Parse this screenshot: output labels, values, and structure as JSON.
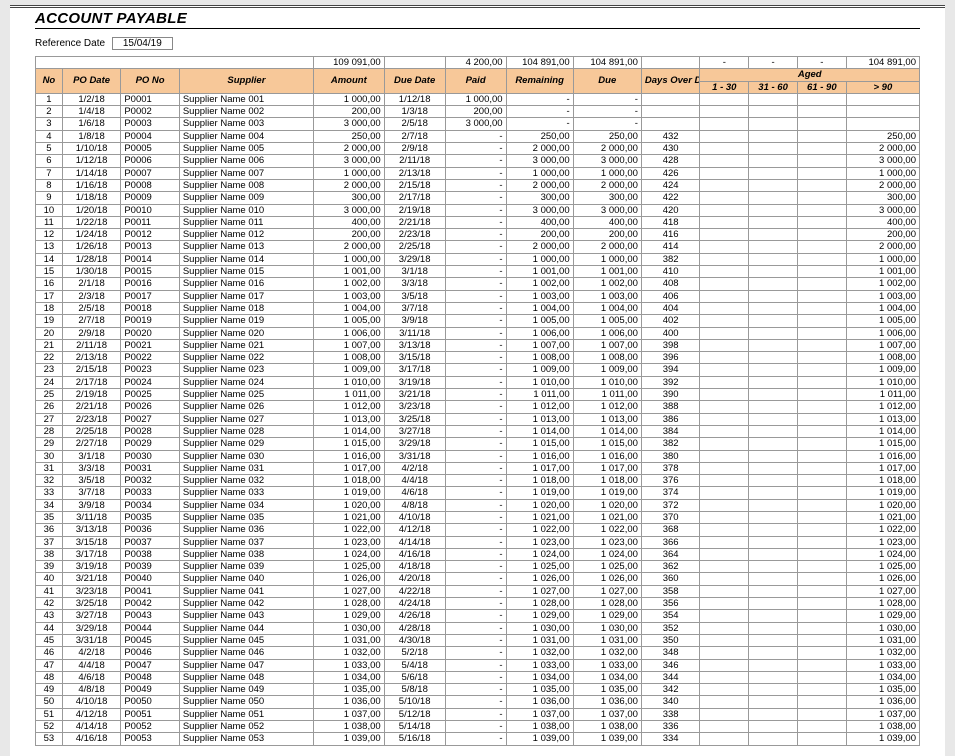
{
  "header": {
    "title": "ACCOUNT PAYABLE",
    "reference_label": "Reference Date",
    "reference_date": "15/04/19"
  },
  "totals": {
    "amount": "109  091,00",
    "paid": "4  200,00",
    "remaining": "104  891,00",
    "due": "104  891,00",
    "b1": "-",
    "b2": "-",
    "b3": "-",
    "b4": "104  891,00"
  },
  "columns": {
    "no": "No",
    "po_date": "PO Date",
    "po_no": "PO No",
    "supplier": "Supplier",
    "amount": "Amount",
    "due_date": "Due Date",
    "paid": "Paid",
    "remaining": "Remaining",
    "due": "Due",
    "days_over": "Days Over Due",
    "aged": "Aged",
    "b1": "1 - 30",
    "b2": "31 - 60",
    "b3": "61 - 90",
    "b4": "> 90"
  },
  "rows": [
    {
      "no": "1",
      "po_date": "1/2/18",
      "po_no": "P0001",
      "supplier": "Supplier Name 001",
      "amount": "1  000,00",
      "due_date": "1/12/18",
      "paid": "1  000,00",
      "remaining": "-",
      "due": "-",
      "days": "",
      "b4": ""
    },
    {
      "no": "2",
      "po_date": "1/4/18",
      "po_no": "P0002",
      "supplier": "Supplier Name 002",
      "amount": "200,00",
      "due_date": "1/3/18",
      "paid": "200,00",
      "remaining": "-",
      "due": "-",
      "days": "",
      "b4": ""
    },
    {
      "no": "3",
      "po_date": "1/6/18",
      "po_no": "P0003",
      "supplier": "Supplier Name 003",
      "amount": "3  000,00",
      "due_date": "2/5/18",
      "paid": "3  000,00",
      "remaining": "-",
      "due": "-",
      "days": "",
      "b4": ""
    },
    {
      "no": "4",
      "po_date": "1/8/18",
      "po_no": "P0004",
      "supplier": "Supplier Name 004",
      "amount": "250,00",
      "due_date": "2/7/18",
      "paid": "-",
      "remaining": "250,00",
      "due": "250,00",
      "days": "432",
      "b4": "250,00"
    },
    {
      "no": "5",
      "po_date": "1/10/18",
      "po_no": "P0005",
      "supplier": "Supplier Name 005",
      "amount": "2  000,00",
      "due_date": "2/9/18",
      "paid": "-",
      "remaining": "2  000,00",
      "due": "2  000,00",
      "days": "430",
      "b4": "2  000,00"
    },
    {
      "no": "6",
      "po_date": "1/12/18",
      "po_no": "P0006",
      "supplier": "Supplier Name 006",
      "amount": "3  000,00",
      "due_date": "2/11/18",
      "paid": "-",
      "remaining": "3  000,00",
      "due": "3  000,00",
      "days": "428",
      "b4": "3  000,00"
    },
    {
      "no": "7",
      "po_date": "1/14/18",
      "po_no": "P0007",
      "supplier": "Supplier Name 007",
      "amount": "1  000,00",
      "due_date": "2/13/18",
      "paid": "-",
      "remaining": "1  000,00",
      "due": "1  000,00",
      "days": "426",
      "b4": "1  000,00"
    },
    {
      "no": "8",
      "po_date": "1/16/18",
      "po_no": "P0008",
      "supplier": "Supplier Name 008",
      "amount": "2  000,00",
      "due_date": "2/15/18",
      "paid": "-",
      "remaining": "2  000,00",
      "due": "2  000,00",
      "days": "424",
      "b4": "2  000,00"
    },
    {
      "no": "9",
      "po_date": "1/18/18",
      "po_no": "P0009",
      "supplier": "Supplier Name 009",
      "amount": "300,00",
      "due_date": "2/17/18",
      "paid": "-",
      "remaining": "300,00",
      "due": "300,00",
      "days": "422",
      "b4": "300,00"
    },
    {
      "no": "10",
      "po_date": "1/20/18",
      "po_no": "P0010",
      "supplier": "Supplier Name 010",
      "amount": "3  000,00",
      "due_date": "2/19/18",
      "paid": "-",
      "remaining": "3  000,00",
      "due": "3  000,00",
      "days": "420",
      "b4": "3  000,00"
    },
    {
      "no": "11",
      "po_date": "1/22/18",
      "po_no": "P0011",
      "supplier": "Supplier Name 011",
      "amount": "400,00",
      "due_date": "2/21/18",
      "paid": "-",
      "remaining": "400,00",
      "due": "400,00",
      "days": "418",
      "b4": "400,00"
    },
    {
      "no": "12",
      "po_date": "1/24/18",
      "po_no": "P0012",
      "supplier": "Supplier Name 012",
      "amount": "200,00",
      "due_date": "2/23/18",
      "paid": "-",
      "remaining": "200,00",
      "due": "200,00",
      "days": "416",
      "b4": "200,00"
    },
    {
      "no": "13",
      "po_date": "1/26/18",
      "po_no": "P0013",
      "supplier": "Supplier Name 013",
      "amount": "2  000,00",
      "due_date": "2/25/18",
      "paid": "-",
      "remaining": "2  000,00",
      "due": "2  000,00",
      "days": "414",
      "b4": "2  000,00"
    },
    {
      "no": "14",
      "po_date": "1/28/18",
      "po_no": "P0014",
      "supplier": "Supplier Name 014",
      "amount": "1  000,00",
      "due_date": "3/29/18",
      "paid": "-",
      "remaining": "1  000,00",
      "due": "1  000,00",
      "days": "382",
      "b4": "1  000,00"
    },
    {
      "no": "15",
      "po_date": "1/30/18",
      "po_no": "P0015",
      "supplier": "Supplier Name 015",
      "amount": "1  001,00",
      "due_date": "3/1/18",
      "paid": "-",
      "remaining": "1  001,00",
      "due": "1  001,00",
      "days": "410",
      "b4": "1  001,00"
    },
    {
      "no": "16",
      "po_date": "2/1/18",
      "po_no": "P0016",
      "supplier": "Supplier Name 016",
      "amount": "1  002,00",
      "due_date": "3/3/18",
      "paid": "-",
      "remaining": "1  002,00",
      "due": "1  002,00",
      "days": "408",
      "b4": "1  002,00"
    },
    {
      "no": "17",
      "po_date": "2/3/18",
      "po_no": "P0017",
      "supplier": "Supplier Name 017",
      "amount": "1  003,00",
      "due_date": "3/5/18",
      "paid": "-",
      "remaining": "1  003,00",
      "due": "1  003,00",
      "days": "406",
      "b4": "1  003,00"
    },
    {
      "no": "18",
      "po_date": "2/5/18",
      "po_no": "P0018",
      "supplier": "Supplier Name 018",
      "amount": "1  004,00",
      "due_date": "3/7/18",
      "paid": "-",
      "remaining": "1  004,00",
      "due": "1  004,00",
      "days": "404",
      "b4": "1  004,00"
    },
    {
      "no": "19",
      "po_date": "2/7/18",
      "po_no": "P0019",
      "supplier": "Supplier Name 019",
      "amount": "1  005,00",
      "due_date": "3/9/18",
      "paid": "-",
      "remaining": "1  005,00",
      "due": "1  005,00",
      "days": "402",
      "b4": "1  005,00"
    },
    {
      "no": "20",
      "po_date": "2/9/18",
      "po_no": "P0020",
      "supplier": "Supplier Name 020",
      "amount": "1  006,00",
      "due_date": "3/11/18",
      "paid": "-",
      "remaining": "1  006,00",
      "due": "1  006,00",
      "days": "400",
      "b4": "1  006,00"
    },
    {
      "no": "21",
      "po_date": "2/11/18",
      "po_no": "P0021",
      "supplier": "Supplier Name 021",
      "amount": "1  007,00",
      "due_date": "3/13/18",
      "paid": "-",
      "remaining": "1  007,00",
      "due": "1  007,00",
      "days": "398",
      "b4": "1  007,00"
    },
    {
      "no": "22",
      "po_date": "2/13/18",
      "po_no": "P0022",
      "supplier": "Supplier Name 022",
      "amount": "1  008,00",
      "due_date": "3/15/18",
      "paid": "-",
      "remaining": "1  008,00",
      "due": "1  008,00",
      "days": "396",
      "b4": "1  008,00"
    },
    {
      "no": "23",
      "po_date": "2/15/18",
      "po_no": "P0023",
      "supplier": "Supplier Name 023",
      "amount": "1  009,00",
      "due_date": "3/17/18",
      "paid": "-",
      "remaining": "1  009,00",
      "due": "1  009,00",
      "days": "394",
      "b4": "1  009,00"
    },
    {
      "no": "24",
      "po_date": "2/17/18",
      "po_no": "P0024",
      "supplier": "Supplier Name 024",
      "amount": "1  010,00",
      "due_date": "3/19/18",
      "paid": "-",
      "remaining": "1  010,00",
      "due": "1  010,00",
      "days": "392",
      "b4": "1  010,00"
    },
    {
      "no": "25",
      "po_date": "2/19/18",
      "po_no": "P0025",
      "supplier": "Supplier Name 025",
      "amount": "1  011,00",
      "due_date": "3/21/18",
      "paid": "-",
      "remaining": "1  011,00",
      "due": "1  011,00",
      "days": "390",
      "b4": "1  011,00"
    },
    {
      "no": "26",
      "po_date": "2/21/18",
      "po_no": "P0026",
      "supplier": "Supplier Name 026",
      "amount": "1  012,00",
      "due_date": "3/23/18",
      "paid": "-",
      "remaining": "1  012,00",
      "due": "1  012,00",
      "days": "388",
      "b4": "1  012,00"
    },
    {
      "no": "27",
      "po_date": "2/23/18",
      "po_no": "P0027",
      "supplier": "Supplier Name 027",
      "amount": "1  013,00",
      "due_date": "3/25/18",
      "paid": "-",
      "remaining": "1  013,00",
      "due": "1  013,00",
      "days": "386",
      "b4": "1  013,00"
    },
    {
      "no": "28",
      "po_date": "2/25/18",
      "po_no": "P0028",
      "supplier": "Supplier Name 028",
      "amount": "1  014,00",
      "due_date": "3/27/18",
      "paid": "-",
      "remaining": "1  014,00",
      "due": "1  014,00",
      "days": "384",
      "b4": "1  014,00"
    },
    {
      "no": "29",
      "po_date": "2/27/18",
      "po_no": "P0029",
      "supplier": "Supplier Name 029",
      "amount": "1  015,00",
      "due_date": "3/29/18",
      "paid": "-",
      "remaining": "1  015,00",
      "due": "1  015,00",
      "days": "382",
      "b4": "1  015,00"
    },
    {
      "no": "30",
      "po_date": "3/1/18",
      "po_no": "P0030",
      "supplier": "Supplier Name 030",
      "amount": "1  016,00",
      "due_date": "3/31/18",
      "paid": "-",
      "remaining": "1  016,00",
      "due": "1  016,00",
      "days": "380",
      "b4": "1  016,00"
    },
    {
      "no": "31",
      "po_date": "3/3/18",
      "po_no": "P0031",
      "supplier": "Supplier Name 031",
      "amount": "1  017,00",
      "due_date": "4/2/18",
      "paid": "-",
      "remaining": "1  017,00",
      "due": "1  017,00",
      "days": "378",
      "b4": "1  017,00"
    },
    {
      "no": "32",
      "po_date": "3/5/18",
      "po_no": "P0032",
      "supplier": "Supplier Name 032",
      "amount": "1  018,00",
      "due_date": "4/4/18",
      "paid": "-",
      "remaining": "1  018,00",
      "due": "1  018,00",
      "days": "376",
      "b4": "1  018,00"
    },
    {
      "no": "33",
      "po_date": "3/7/18",
      "po_no": "P0033",
      "supplier": "Supplier Name 033",
      "amount": "1  019,00",
      "due_date": "4/6/18",
      "paid": "-",
      "remaining": "1  019,00",
      "due": "1  019,00",
      "days": "374",
      "b4": "1  019,00"
    },
    {
      "no": "34",
      "po_date": "3/9/18",
      "po_no": "P0034",
      "supplier": "Supplier Name 034",
      "amount": "1  020,00",
      "due_date": "4/8/18",
      "paid": "-",
      "remaining": "1  020,00",
      "due": "1  020,00",
      "days": "372",
      "b4": "1  020,00"
    },
    {
      "no": "35",
      "po_date": "3/11/18",
      "po_no": "P0035",
      "supplier": "Supplier Name 035",
      "amount": "1  021,00",
      "due_date": "4/10/18",
      "paid": "-",
      "remaining": "1  021,00",
      "due": "1  021,00",
      "days": "370",
      "b4": "1  021,00"
    },
    {
      "no": "36",
      "po_date": "3/13/18",
      "po_no": "P0036",
      "supplier": "Supplier Name 036",
      "amount": "1  022,00",
      "due_date": "4/12/18",
      "paid": "-",
      "remaining": "1  022,00",
      "due": "1  022,00",
      "days": "368",
      "b4": "1  022,00"
    },
    {
      "no": "37",
      "po_date": "3/15/18",
      "po_no": "P0037",
      "supplier": "Supplier Name 037",
      "amount": "1  023,00",
      "due_date": "4/14/18",
      "paid": "-",
      "remaining": "1  023,00",
      "due": "1  023,00",
      "days": "366",
      "b4": "1  023,00"
    },
    {
      "no": "38",
      "po_date": "3/17/18",
      "po_no": "P0038",
      "supplier": "Supplier Name 038",
      "amount": "1  024,00",
      "due_date": "4/16/18",
      "paid": "-",
      "remaining": "1  024,00",
      "due": "1  024,00",
      "days": "364",
      "b4": "1  024,00"
    },
    {
      "no": "39",
      "po_date": "3/19/18",
      "po_no": "P0039",
      "supplier": "Supplier Name 039",
      "amount": "1  025,00",
      "due_date": "4/18/18",
      "paid": "-",
      "remaining": "1  025,00",
      "due": "1  025,00",
      "days": "362",
      "b4": "1  025,00"
    },
    {
      "no": "40",
      "po_date": "3/21/18",
      "po_no": "P0040",
      "supplier": "Supplier Name 040",
      "amount": "1  026,00",
      "due_date": "4/20/18",
      "paid": "-",
      "remaining": "1  026,00",
      "due": "1  026,00",
      "days": "360",
      "b4": "1  026,00"
    },
    {
      "no": "41",
      "po_date": "3/23/18",
      "po_no": "P0041",
      "supplier": "Supplier Name 041",
      "amount": "1  027,00",
      "due_date": "4/22/18",
      "paid": "-",
      "remaining": "1  027,00",
      "due": "1  027,00",
      "days": "358",
      "b4": "1  027,00"
    },
    {
      "no": "42",
      "po_date": "3/25/18",
      "po_no": "P0042",
      "supplier": "Supplier Name 042",
      "amount": "1  028,00",
      "due_date": "4/24/18",
      "paid": "-",
      "remaining": "1  028,00",
      "due": "1  028,00",
      "days": "356",
      "b4": "1  028,00"
    },
    {
      "no": "43",
      "po_date": "3/27/18",
      "po_no": "P0043",
      "supplier": "Supplier Name 043",
      "amount": "1  029,00",
      "due_date": "4/26/18",
      "paid": "-",
      "remaining": "1  029,00",
      "due": "1  029,00",
      "days": "354",
      "b4": "1  029,00"
    },
    {
      "no": "44",
      "po_date": "3/29/18",
      "po_no": "P0044",
      "supplier": "Supplier Name 044",
      "amount": "1  030,00",
      "due_date": "4/28/18",
      "paid": "-",
      "remaining": "1  030,00",
      "due": "1  030,00",
      "days": "352",
      "b4": "1  030,00"
    },
    {
      "no": "45",
      "po_date": "3/31/18",
      "po_no": "P0045",
      "supplier": "Supplier Name 045",
      "amount": "1  031,00",
      "due_date": "4/30/18",
      "paid": "-",
      "remaining": "1  031,00",
      "due": "1  031,00",
      "days": "350",
      "b4": "1  031,00"
    },
    {
      "no": "46",
      "po_date": "4/2/18",
      "po_no": "P0046",
      "supplier": "Supplier Name 046",
      "amount": "1  032,00",
      "due_date": "5/2/18",
      "paid": "-",
      "remaining": "1  032,00",
      "due": "1  032,00",
      "days": "348",
      "b4": "1  032,00"
    },
    {
      "no": "47",
      "po_date": "4/4/18",
      "po_no": "P0047",
      "supplier": "Supplier Name 047",
      "amount": "1  033,00",
      "due_date": "5/4/18",
      "paid": "-",
      "remaining": "1  033,00",
      "due": "1  033,00",
      "days": "346",
      "b4": "1  033,00"
    },
    {
      "no": "48",
      "po_date": "4/6/18",
      "po_no": "P0048",
      "supplier": "Supplier Name 048",
      "amount": "1  034,00",
      "due_date": "5/6/18",
      "paid": "-",
      "remaining": "1  034,00",
      "due": "1  034,00",
      "days": "344",
      "b4": "1  034,00"
    },
    {
      "no": "49",
      "po_date": "4/8/18",
      "po_no": "P0049",
      "supplier": "Supplier Name 049",
      "amount": "1  035,00",
      "due_date": "5/8/18",
      "paid": "-",
      "remaining": "1  035,00",
      "due": "1  035,00",
      "days": "342",
      "b4": "1  035,00"
    },
    {
      "no": "50",
      "po_date": "4/10/18",
      "po_no": "P0050",
      "supplier": "Supplier Name 050",
      "amount": "1  036,00",
      "due_date": "5/10/18",
      "paid": "-",
      "remaining": "1  036,00",
      "due": "1  036,00",
      "days": "340",
      "b4": "1  036,00"
    },
    {
      "no": "51",
      "po_date": "4/12/18",
      "po_no": "P0051",
      "supplier": "Supplier Name 051",
      "amount": "1  037,00",
      "due_date": "5/12/18",
      "paid": "-",
      "remaining": "1  037,00",
      "due": "1  037,00",
      "days": "338",
      "b4": "1  037,00"
    },
    {
      "no": "52",
      "po_date": "4/14/18",
      "po_no": "P0052",
      "supplier": "Supplier Name 052",
      "amount": "1  038,00",
      "due_date": "5/14/18",
      "paid": "-",
      "remaining": "1  038,00",
      "due": "1  038,00",
      "days": "336",
      "b4": "1  038,00"
    },
    {
      "no": "53",
      "po_date": "4/16/18",
      "po_no": "P0053",
      "supplier": "Supplier Name 053",
      "amount": "1  039,00",
      "due_date": "5/16/18",
      "paid": "-",
      "remaining": "1  039,00",
      "due": "1  039,00",
      "days": "334",
      "b4": "1  039,00"
    }
  ]
}
